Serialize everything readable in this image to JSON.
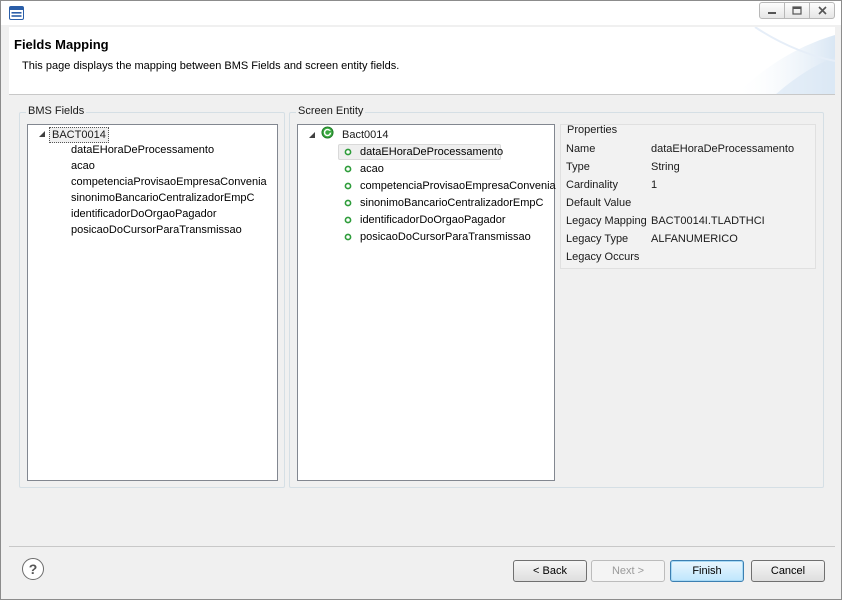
{
  "header": {
    "title": "Fields Mapping",
    "description": "This page displays the mapping between BMS Fields and screen entity fields."
  },
  "bms_fields": {
    "group_label": "BMS Fields",
    "root": "BACT0014",
    "items": [
      "dataEHoraDeProcessamento",
      "acao",
      "competenciaProvisaoEmpresaConvenia",
      "sinonimoBancarioCentralizadorEmpC",
      "identificadorDoOrgaoPagador",
      "posicaoDoCursorParaTransmissao"
    ]
  },
  "screen_entity": {
    "group_label": "Screen Entity",
    "root": "Bact0014",
    "items": [
      "dataEHoraDeProcessamento",
      "acao",
      "competenciaProvisaoEmpresaConvenia",
      "sinonimoBancarioCentralizadorEmpC",
      "identificadorDoOrgaoPagador",
      "posicaoDoCursorParaTransmissao"
    ]
  },
  "properties": {
    "label": "Properties",
    "rows": [
      {
        "name": "Name",
        "value": "dataEHoraDeProcessamento"
      },
      {
        "name": "Type",
        "value": "String"
      },
      {
        "name": "Cardinality",
        "value": "1"
      },
      {
        "name": "Default Value",
        "value": ""
      },
      {
        "name": "Legacy Mapping",
        "value": "BACT0014I.TLADTHCI"
      },
      {
        "name": "Legacy Type",
        "value": "ALFANUMERICO"
      },
      {
        "name": "Legacy Occurs",
        "value": ""
      }
    ]
  },
  "footer": {
    "help_glyph": "?",
    "back_label": "< Back",
    "next_label": "Next >",
    "finish_label": "Finish",
    "cancel_label": "Cancel"
  },
  "colors": {
    "accent_blue": "#3c7fb1",
    "field_icon_green": "#2e9c3a"
  }
}
